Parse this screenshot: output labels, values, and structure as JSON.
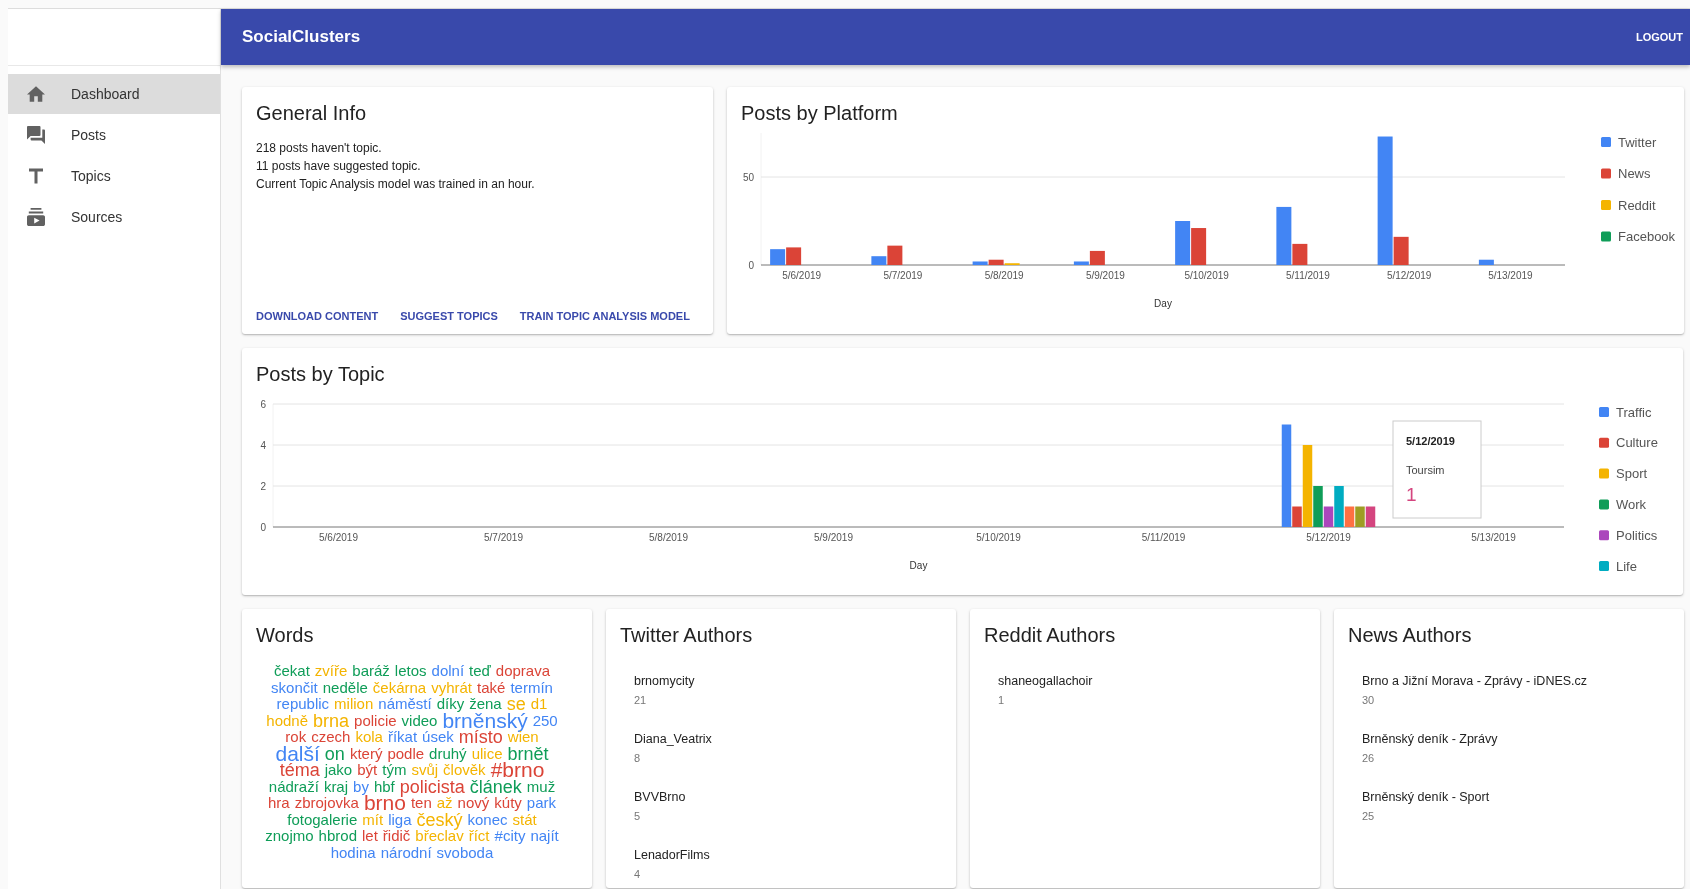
{
  "app_bar": {
    "title": "SocialClusters",
    "logout": "LOGOUT"
  },
  "sidebar": {
    "items": [
      {
        "label": "Dashboard",
        "selected": true
      },
      {
        "label": "Posts",
        "selected": false
      },
      {
        "label": "Topics",
        "selected": false
      },
      {
        "label": "Sources",
        "selected": false
      }
    ]
  },
  "general_info": {
    "title": "General Info",
    "lines": [
      "218 posts haven't topic.",
      "11 posts have suggested topic.",
      "Current Topic Analysis model was trained in an hour."
    ],
    "actions": [
      "DOWNLOAD CONTENT",
      "SUGGEST TOPICS",
      "TRAIN TOPIC ANALYSIS MODEL"
    ]
  },
  "posts_by_platform": {
    "title": "Posts by Platform",
    "chart_data": {
      "type": "bar",
      "xlabel": "Day",
      "categories": [
        "5/6/2019",
        "5/7/2019",
        "5/8/2019",
        "5/9/2019",
        "5/10/2019",
        "5/11/2019",
        "5/12/2019",
        "5/13/2019"
      ],
      "ylim": [
        0,
        75
      ],
      "yticks": [
        0,
        50
      ],
      "legend": true,
      "series": [
        {
          "name": "Twitter",
          "color": "#4285f4",
          "values": [
            9,
            5,
            2,
            2,
            25,
            33,
            73,
            3
          ]
        },
        {
          "name": "News",
          "color": "#db4437",
          "values": [
            10,
            11,
            3,
            8,
            21,
            12,
            16,
            0
          ]
        },
        {
          "name": "Reddit",
          "color": "#f4b400",
          "values": [
            0,
            0,
            1,
            0,
            0,
            0,
            0,
            0
          ]
        },
        {
          "name": "Facebook",
          "color": "#0f9d58",
          "values": [
            0,
            0,
            0,
            0,
            0,
            0,
            0,
            0
          ]
        }
      ]
    }
  },
  "posts_by_topic": {
    "title": "Posts by Topic",
    "chart_data": {
      "type": "bar",
      "xlabel": "Day",
      "categories": [
        "5/6/2019",
        "5/7/2019",
        "5/8/2019",
        "5/9/2019",
        "5/10/2019",
        "5/11/2019",
        "5/12/2019",
        "5/13/2019"
      ],
      "ylim": [
        0,
        6
      ],
      "yticks": [
        0,
        2,
        4,
        6
      ],
      "legend": true,
      "series": [
        {
          "name": "Traffic",
          "color": "#4285f4",
          "values": [
            0,
            0,
            0,
            0,
            0,
            0,
            5,
            0
          ]
        },
        {
          "name": "Culture",
          "color": "#db4437",
          "values": [
            0,
            0,
            0,
            0,
            0,
            0,
            1,
            0
          ]
        },
        {
          "name": "Sport",
          "color": "#f4b400",
          "values": [
            0,
            0,
            0,
            0,
            0,
            0,
            4,
            0
          ]
        },
        {
          "name": "Work",
          "color": "#0f9d58",
          "values": [
            0,
            0,
            0,
            0,
            0,
            0,
            2,
            0
          ]
        },
        {
          "name": "Politics",
          "color": "#ab47bc",
          "values": [
            0,
            0,
            0,
            0,
            0,
            0,
            1,
            0
          ]
        },
        {
          "name": "Life",
          "color": "#00acc1",
          "values": [
            0,
            0,
            0,
            0,
            0,
            0,
            2,
            0
          ]
        },
        {
          "color": "#ff7043",
          "values": [
            0,
            0,
            0,
            0,
            0,
            0,
            1,
            0
          ]
        },
        {
          "color": "#9e9d24",
          "values": [
            0,
            0,
            0,
            0,
            0,
            0,
            1,
            0
          ]
        },
        {
          "color": "#d4457f",
          "values": [
            0,
            0,
            0,
            0,
            0,
            0,
            1,
            0
          ]
        }
      ]
    },
    "tooltip": {
      "title": "5/12/2019",
      "label": "Toursim",
      "value": "1"
    }
  },
  "words": {
    "title": "Words",
    "items": [
      {
        "text": "čekat",
        "color": "#0f9d58",
        "kind": "small"
      },
      {
        "text": "zvíře",
        "color": "#f4b400",
        "kind": "small"
      },
      {
        "text": "baráž",
        "color": "#0f9d58",
        "kind": "small"
      },
      {
        "text": "letos",
        "color": "#0f9d58",
        "kind": "small"
      },
      {
        "text": "dolní",
        "color": "#4285f4",
        "kind": "small"
      },
      {
        "text": "teď",
        "color": "#0f9d58",
        "kind": "small"
      },
      {
        "text": "doprava",
        "color": "#db4437",
        "kind": "small"
      },
      {
        "text": "skončit",
        "color": "#4285f4",
        "kind": "small"
      },
      {
        "text": "neděle",
        "color": "#0f9d58",
        "kind": "small"
      },
      {
        "text": "čekárna",
        "color": "#f4b400",
        "kind": "small"
      },
      {
        "text": "vyhrát",
        "color": "#f4b400",
        "kind": "small"
      },
      {
        "text": "také",
        "color": "#db4437",
        "kind": "small"
      },
      {
        "text": "termín",
        "color": "#4285f4",
        "kind": "small"
      },
      {
        "text": "republic",
        "color": "#4285f4",
        "kind": "small"
      },
      {
        "text": "milion",
        "color": "#f4b400",
        "kind": "small"
      },
      {
        "text": "náměstí",
        "color": "#4285f4",
        "kind": "small"
      },
      {
        "text": "díky",
        "color": "#0f9d58",
        "kind": "small"
      },
      {
        "text": "žena",
        "color": "#0f9d58",
        "kind": "small"
      },
      {
        "text": "se",
        "color": "#f4b400",
        "kind": "medium"
      },
      {
        "text": "d1",
        "color": "#f4b400",
        "kind": "small"
      },
      {
        "text": "hodně",
        "color": "#f4b400",
        "kind": "small"
      },
      {
        "text": "brna",
        "color": "#f4b400",
        "kind": "medium"
      },
      {
        "text": "policie",
        "color": "#db4437",
        "kind": "small"
      },
      {
        "text": "video",
        "color": "#0f9d58",
        "kind": "small"
      },
      {
        "text": "brněnský",
        "color": "#4285f4",
        "kind": "large"
      },
      {
        "text": "250",
        "color": "#4285f4",
        "kind": "small"
      },
      {
        "text": "rok",
        "color": "#db4437",
        "kind": "small"
      },
      {
        "text": "czech",
        "color": "#db4437",
        "kind": "small"
      },
      {
        "text": "kola",
        "color": "#f4b400",
        "kind": "small"
      },
      {
        "text": "říkat",
        "color": "#4285f4",
        "kind": "small"
      },
      {
        "text": "úsek",
        "color": "#4285f4",
        "kind": "small"
      },
      {
        "text": "místo",
        "color": "#db4437",
        "kind": "medium"
      },
      {
        "text": "wien",
        "color": "#f4b400",
        "kind": "small"
      },
      {
        "text": "další",
        "color": "#4285f4",
        "kind": "large"
      },
      {
        "text": "on",
        "color": "#0f9d58",
        "kind": "medium"
      },
      {
        "text": "který",
        "color": "#db4437",
        "kind": "small"
      },
      {
        "text": "podle",
        "color": "#db4437",
        "kind": "small"
      },
      {
        "text": "druhý",
        "color": "#0f9d58",
        "kind": "small"
      },
      {
        "text": "ulice",
        "color": "#f4b400",
        "kind": "small"
      },
      {
        "text": "brnět",
        "color": "#0f9d58",
        "kind": "medium"
      },
      {
        "text": "téma",
        "color": "#db4437",
        "kind": "medium"
      },
      {
        "text": "jako",
        "color": "#0f9d58",
        "kind": "small"
      },
      {
        "text": "být",
        "color": "#db4437",
        "kind": "small"
      },
      {
        "text": "tým",
        "color": "#0f9d58",
        "kind": "small"
      },
      {
        "text": "svůj",
        "color": "#f4b400",
        "kind": "small"
      },
      {
        "text": "člověk",
        "color": "#f4b400",
        "kind": "small"
      },
      {
        "text": "#brno",
        "color": "#db4437",
        "kind": "large"
      },
      {
        "text": "nádraží",
        "color": "#0f9d58",
        "kind": "small"
      },
      {
        "text": "kraj",
        "color": "#0f9d58",
        "kind": "small"
      },
      {
        "text": "by",
        "color": "#4285f4",
        "kind": "small"
      },
      {
        "text": "hbf",
        "color": "#0f9d58",
        "kind": "small"
      },
      {
        "text": "policista",
        "color": "#db4437",
        "kind": "medium"
      },
      {
        "text": "článek",
        "color": "#0f9d58",
        "kind": "medium"
      },
      {
        "text": "muž",
        "color": "#0f9d58",
        "kind": "small"
      },
      {
        "text": "hra",
        "color": "#db4437",
        "kind": "small"
      },
      {
        "text": "zbrojovka",
        "color": "#db4437",
        "kind": "small"
      },
      {
        "text": "brno",
        "color": "#db4437",
        "kind": "large"
      },
      {
        "text": "ten",
        "color": "#db4437",
        "kind": "small"
      },
      {
        "text": "až",
        "color": "#f4b400",
        "kind": "small"
      },
      {
        "text": "nový",
        "color": "#db4437",
        "kind": "small"
      },
      {
        "text": "kúty",
        "color": "#db4437",
        "kind": "small"
      },
      {
        "text": "park",
        "color": "#4285f4",
        "kind": "small"
      },
      {
        "text": "fotogalerie",
        "color": "#0f9d58",
        "kind": "small"
      },
      {
        "text": "mít",
        "color": "#f4b400",
        "kind": "small"
      },
      {
        "text": "liga",
        "color": "#4285f4",
        "kind": "small"
      },
      {
        "text": "český",
        "color": "#f4b400",
        "kind": "medium"
      },
      {
        "text": "konec",
        "color": "#4285f4",
        "kind": "small"
      },
      {
        "text": "stát",
        "color": "#f4b400",
        "kind": "small"
      },
      {
        "text": "znojmo",
        "color": "#0f9d58",
        "kind": "small"
      },
      {
        "text": "hbrod",
        "color": "#0f9d58",
        "kind": "small"
      },
      {
        "text": "let",
        "color": "#db4437",
        "kind": "small"
      },
      {
        "text": "řidič",
        "color": "#db4437",
        "kind": "small"
      },
      {
        "text": "břeclav",
        "color": "#f4b400",
        "kind": "small"
      },
      {
        "text": "říct",
        "color": "#f4b400",
        "kind": "small"
      },
      {
        "text": "#city",
        "color": "#4285f4",
        "kind": "small"
      },
      {
        "text": "najít",
        "color": "#4285f4",
        "kind": "small"
      },
      {
        "text": "hodina",
        "color": "#4285f4",
        "kind": "small"
      },
      {
        "text": "národní",
        "color": "#4285f4",
        "kind": "small"
      },
      {
        "text": "svoboda",
        "color": "#4285f4",
        "kind": "small"
      }
    ]
  },
  "author_panels": [
    {
      "title": "Twitter Authors",
      "authors": [
        {
          "name": "brnomycity",
          "count": "21"
        },
        {
          "name": "Diana_Veatrix",
          "count": "8"
        },
        {
          "name": "BVVBrno",
          "count": "5"
        },
        {
          "name": "LenadorFilms",
          "count": "4"
        }
      ]
    },
    {
      "title": "Reddit Authors",
      "authors": [
        {
          "name": "shaneogallachoir",
          "count": "1"
        }
      ]
    },
    {
      "title": "News Authors",
      "authors": [
        {
          "name": "Brno a Jižní Morava - Zprávy - iDNES.cz",
          "count": "30"
        },
        {
          "name": "Brněnský deník - Zprávy",
          "count": "26"
        },
        {
          "name": "Brněnský deník - Sport",
          "count": "25"
        }
      ]
    }
  ]
}
